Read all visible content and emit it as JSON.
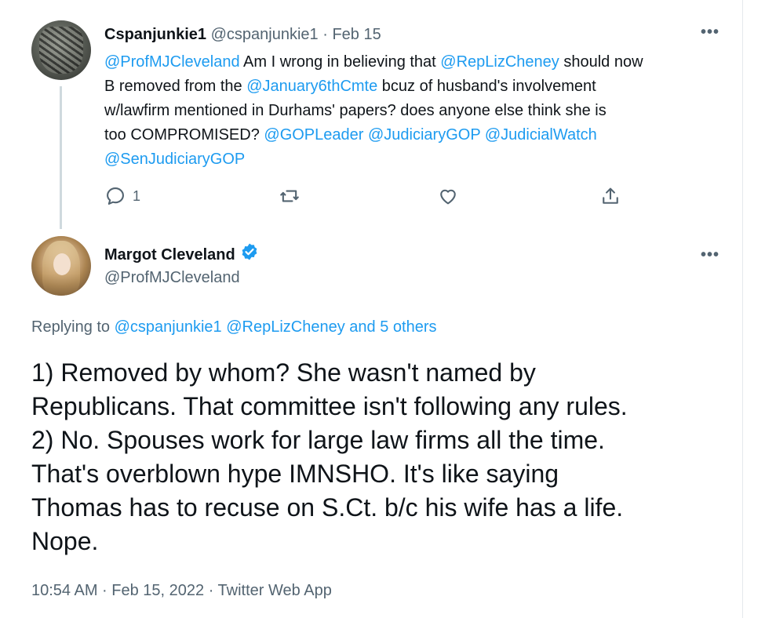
{
  "parent_tweet": {
    "author_name": "Cspanjunkie1",
    "author_handle": "@cspanjunkie1",
    "separator": "·",
    "date": "Feb 15",
    "more_label": "•••",
    "body_lines": [
      [
        {
          "text": "@ProfMJCleveland",
          "link": true
        },
        {
          "text": " Am I wrong in believing that ",
          "link": false
        },
        {
          "text": "@RepLizCheney",
          "link": true
        },
        {
          "text": " should now",
          "link": false
        }
      ],
      [
        {
          "text": "B removed from the ",
          "link": false
        },
        {
          "text": "@January6thCmte",
          "link": true
        },
        {
          "text": " bcuz of husband's involvement",
          "link": false
        }
      ],
      [
        {
          "text": "w/lawfirm mentioned in Durhams' papers? does anyone else think she is",
          "link": false
        }
      ],
      [
        {
          "text": "too COMPROMISED? ",
          "link": false
        },
        {
          "text": "@GOPLeader",
          "link": true
        },
        {
          "text": " ",
          "link": false
        },
        {
          "text": "@JudiciaryGOP",
          "link": true
        },
        {
          "text": " ",
          "link": false
        },
        {
          "text": "@JudicialWatch",
          "link": true
        }
      ],
      [
        {
          "text": "@SenJudiciaryGOP",
          "link": true
        }
      ]
    ],
    "actions": {
      "reply_icon": "reply-icon",
      "reply_count": "1",
      "retweet_icon": "retweet-icon",
      "like_icon": "heart-icon",
      "share_icon": "share-icon"
    }
  },
  "main_tweet": {
    "author_name": "Margot Cleveland",
    "author_handle": "@ProfMJCleveland",
    "verified_icon": "verified-badge-icon",
    "more_label": "•••",
    "replying_prefix": "Replying to ",
    "replying_to": "@cspanjunkie1 @RepLizCheney and 5 others",
    "body_lines": [
      "1) Removed by whom?  She wasn't named by",
      "Republicans.  That committee isn't following any rules.",
      "2) No. Spouses work for large law firms all the time.",
      "That's overblown hype IMNSHO.  It's like saying",
      "Thomas has to recuse on S.Ct. b/c his wife has a life.",
      "Nope."
    ],
    "timestamp": "10:54 AM · Feb 15, 2022 · Twitter Web App"
  },
  "colors": {
    "link": "#1d9bf0",
    "muted": "#536471",
    "text": "#0f1419",
    "thread_line": "#cfd9de"
  }
}
